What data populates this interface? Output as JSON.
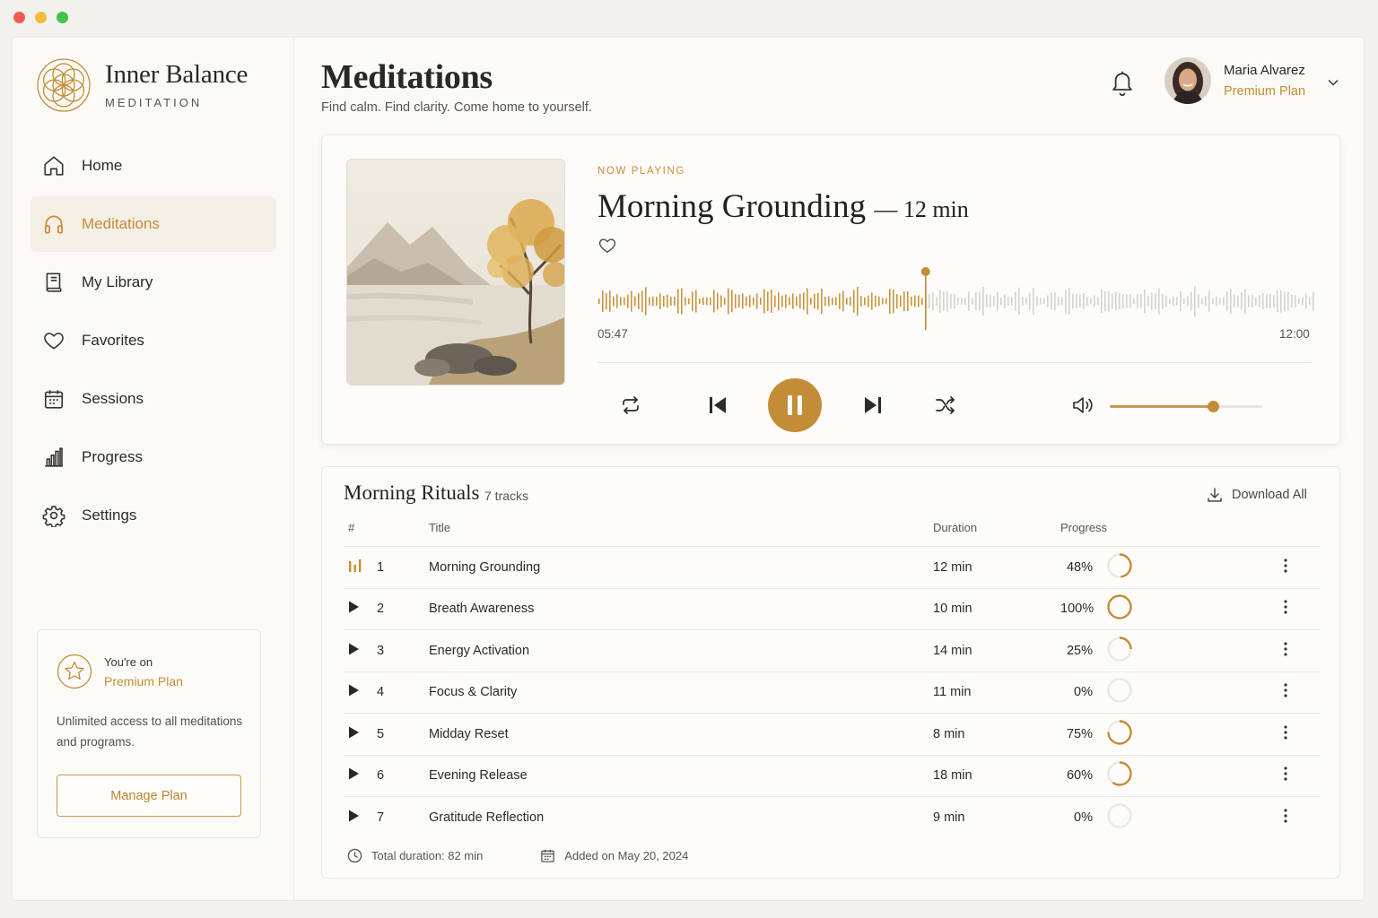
{
  "window": {
    "controls": [
      "close",
      "minimize",
      "maximize"
    ]
  },
  "brand": {
    "title": "Inner Balance",
    "subtitle": "MEDITATION",
    "logo_icon": "flower-of-life-logo",
    "accent": "#c38d37"
  },
  "nav": {
    "active": "meditations",
    "items": [
      {
        "id": "home",
        "label": "Home",
        "icon": "home-icon"
      },
      {
        "id": "meditations",
        "label": "Meditations",
        "icon": "headphones-icon"
      },
      {
        "id": "library",
        "label": "My Library",
        "icon": "book-icon"
      },
      {
        "id": "favorites",
        "label": "Favorites",
        "icon": "heart-icon"
      },
      {
        "id": "sessions",
        "label": "Sessions",
        "icon": "calendar-icon"
      },
      {
        "id": "progress",
        "label": "Progress",
        "icon": "bar-chart-icon"
      },
      {
        "id": "settings",
        "label": "Settings",
        "icon": "gear-icon"
      }
    ]
  },
  "plan_card": {
    "small": "You're on",
    "plan": "Premium Plan",
    "description": "Unlimited access to all meditations and programs.",
    "button": "Manage Plan",
    "icon": "star-badge-icon"
  },
  "header": {
    "title": "Meditations",
    "subtitle": "Find calm. Find clarity. Come home to yourself."
  },
  "user": {
    "name": "Maria Alvarez",
    "plan": "Premium Plan"
  },
  "player": {
    "label": "NOW PLAYING",
    "title": "Morning Grounding",
    "duration": "12 min",
    "current_time": "05:47",
    "total_time": "12:00",
    "progress": 0.48,
    "volume": 0.68,
    "liked": false,
    "controls": [
      "repeat-icon",
      "previous-icon",
      "pause-icon",
      "next-icon",
      "shuffle-icon",
      "volume-icon"
    ]
  },
  "playlist": {
    "title": "Morning Rituals",
    "count": "7 tracks",
    "download": "Download All",
    "columns": {
      "num": "#",
      "title": "Title",
      "duration": "Duration",
      "progress": "Progress"
    },
    "rows": [
      {
        "num": "1",
        "title": "Morning Grounding",
        "duration": "12 min",
        "progress": "48%",
        "value": 0.48,
        "playing": true
      },
      {
        "num": "2",
        "title": "Breath Awareness",
        "duration": "10 min",
        "progress": "100%",
        "value": 1.0,
        "playing": false
      },
      {
        "num": "3",
        "title": "Energy Activation",
        "duration": "14 min",
        "progress": "25%",
        "value": 0.25,
        "playing": false
      },
      {
        "num": "4",
        "title": "Focus & Clarity",
        "duration": "11 min",
        "progress": "0%",
        "value": 0,
        "playing": false
      },
      {
        "num": "5",
        "title": "Midday Reset",
        "duration": "8 min",
        "progress": "75%",
        "value": 0.75,
        "playing": false
      },
      {
        "num": "6",
        "title": "Evening Release",
        "duration": "18 min",
        "progress": "60%",
        "value": 0.6,
        "playing": false
      },
      {
        "num": "7",
        "title": "Gratitude Reflection",
        "duration": "9 min",
        "progress": "0%",
        "value": 0,
        "playing": false
      }
    ],
    "total": "Total duration: 82 min",
    "added": "Added on May 20, 2024"
  }
}
